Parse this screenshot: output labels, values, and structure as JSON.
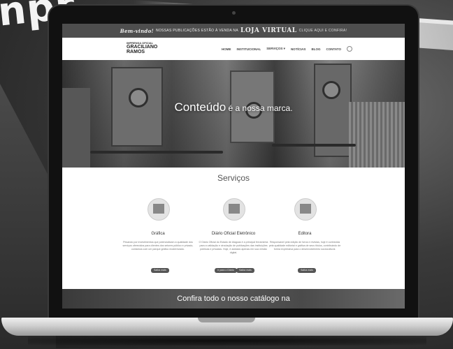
{
  "background": {
    "brand_fragment": "npr"
  },
  "topbar": {
    "greeting": "Bem-vindo!",
    "message": "NOSSAS PUBLICAÇÕES ESTÃO À VENDA NA",
    "store": "LOJA VIRTUAL",
    "cta": "CLIQUE AQUI E CONFIRA!"
  },
  "logo": {
    "line1": "IMPRENSA OFICIAL",
    "line2": "GRACILIANO",
    "line3": "RAMOS"
  },
  "nav": {
    "items": [
      "HOME",
      "INSTITUCIONAL",
      "SERVIÇOS ▾",
      "NOTÍCIAS",
      "BLOG",
      "CONTATO"
    ]
  },
  "hero": {
    "headline_big": "Conteúdo",
    "headline_small": " é a nossa marca."
  },
  "services": {
    "title": "Serviços",
    "cards": [
      {
        "title": "Gráfica",
        "description": "Pesando por investimentos que potencializam a qualidade dos serviços oferecidos para clientes dos setores público e privado, contamos com um parque gráfico modernizado.",
        "buttons": [
          "Saiba mais"
        ]
      },
      {
        "title": "Diário Oficial Eletrônico",
        "description": "O Diário Oficial do Estado de Alagoas é a principal ferramenta para a validação e circulação de publicações das instituições públicas e privadas. Hoje, é adotado apenas em sua versão digital.",
        "buttons": [
          "Ir para o Diário",
          "Saiba mais"
        ]
      },
      {
        "title": "Editora",
        "description": "Responsável pela edição de livros e revistas, hoje é conhecida pela qualidade editorial e gráfica de seus títulos, contribuindo de forma expressiva para o desenvolvimento sociocultural.",
        "buttons": [
          "Saiba mais"
        ]
      }
    ]
  },
  "catalog": {
    "text": "Confira todo o nosso catálogo na"
  },
  "colors": {
    "topbar": "#4e4e4e",
    "button": "#555555",
    "text_dark": "#333333"
  }
}
